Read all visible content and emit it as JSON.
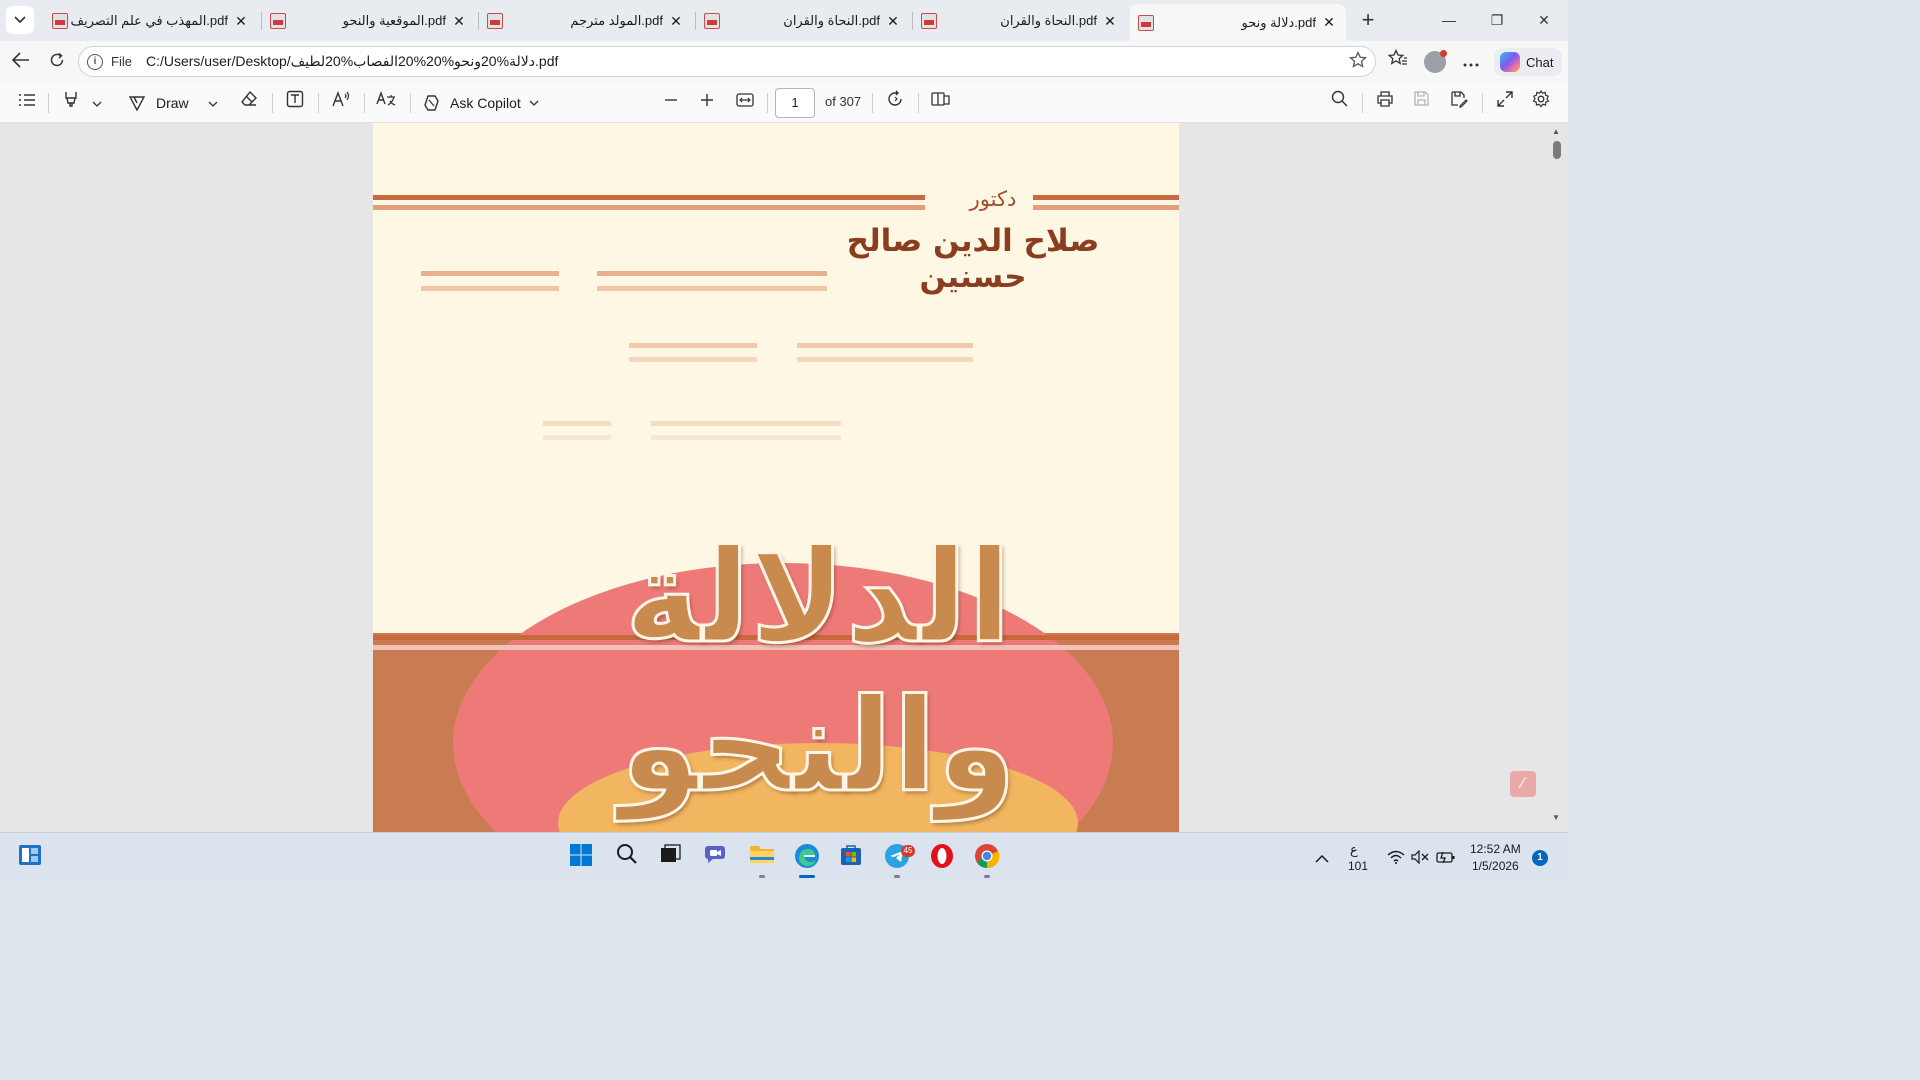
{
  "tabs": [
    {
      "title": "pdf.المهذب في علم التصريف",
      "active": false
    },
    {
      "title": "pdf.الموقعية والنحو",
      "active": false
    },
    {
      "title": "pdf.المولد مترجم",
      "active": false
    },
    {
      "title": "pdf.النحاة والقران",
      "active": false
    },
    {
      "title": "pdf.النحاة والقران",
      "active": false
    },
    {
      "title": "pdf.دلالة ونحو",
      "active": true
    }
  ],
  "tab_close_glyph": "✕",
  "new_tab_glyph": "+",
  "window_controls": {
    "minimize": "—",
    "restore": "❐",
    "close": "✕"
  },
  "address": {
    "scheme": "File",
    "url": "C:/Users/user/Desktop/دلالة%20ونحو%20%20الفصاب%20لطيف.pdf",
    "info_glyph": "i"
  },
  "addressbar_actions": {
    "chat_label": "Chat"
  },
  "pdf_toolbar": {
    "draw_label": "Draw",
    "ask_copilot_label": "Ask Copilot",
    "page_current": "1",
    "page_total_label": "of 307"
  },
  "document": {
    "author_title": "دكتور",
    "author_name": "صلاح الدين صالح حسنين",
    "book_title": "الدلالة والنحو",
    "colors": {
      "page_bg": "#fdf7e3",
      "stripe": "#c8683f",
      "title": "#c98a4e",
      "lower": "#c97b52",
      "pink": "#ee7a78",
      "gold": "#f2b560"
    }
  },
  "taskbar": {
    "telegram_badge": "45",
    "language": "ع",
    "language_sub": "101",
    "time": "12:52 AM",
    "date": "1/5/2026",
    "notification_count": "1"
  },
  "icons": [
    "tab-list-icon",
    "pdf-icon",
    "back-icon",
    "refresh-icon",
    "info-icon",
    "star-icon",
    "favorites-icon",
    "profile-icon",
    "more-icon",
    "copilot-icon",
    "contents-icon",
    "highlight-icon",
    "draw-icon",
    "eraser-icon",
    "text-box-icon",
    "read-aloud-icon",
    "translate-icon",
    "copilot-icon",
    "zoom-out-icon",
    "zoom-in-icon",
    "fit-width-icon",
    "rotate-icon",
    "page-view-icon",
    "search-icon",
    "print-icon",
    "save-icon",
    "save-as-icon",
    "fullscreen-icon",
    "settings-icon",
    "windows-start-icon",
    "search-icon",
    "task-view-icon",
    "teams-icon",
    "file-explorer-icon",
    "edge-icon",
    "store-icon",
    "telegram-icon",
    "opera-icon",
    "chrome-icon",
    "wifi-icon",
    "mute-icon",
    "battery-icon"
  ]
}
